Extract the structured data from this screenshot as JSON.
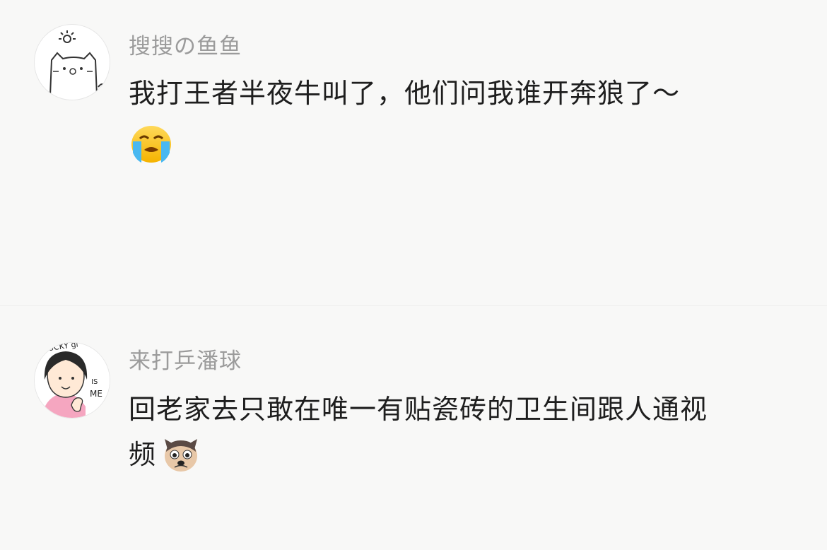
{
  "comments": [
    {
      "username": "搜搜の鱼鱼",
      "text": "我打王者半夜牛叫了，他们问我谁开奔狼了～",
      "emoji": "loudly-crying-face"
    },
    {
      "username": "来打乒潘球",
      "text_line1": "回老家去只敢在唯一有贴瓷砖的卫生间跟人通视",
      "text_line2": "频",
      "emoji": "puppy-face",
      "avatar_text": "LUCKY girl IS ME"
    }
  ],
  "colors": {
    "background": "#f8f8f7",
    "username": "#9b9b9b",
    "text": "#1e1e1e"
  }
}
